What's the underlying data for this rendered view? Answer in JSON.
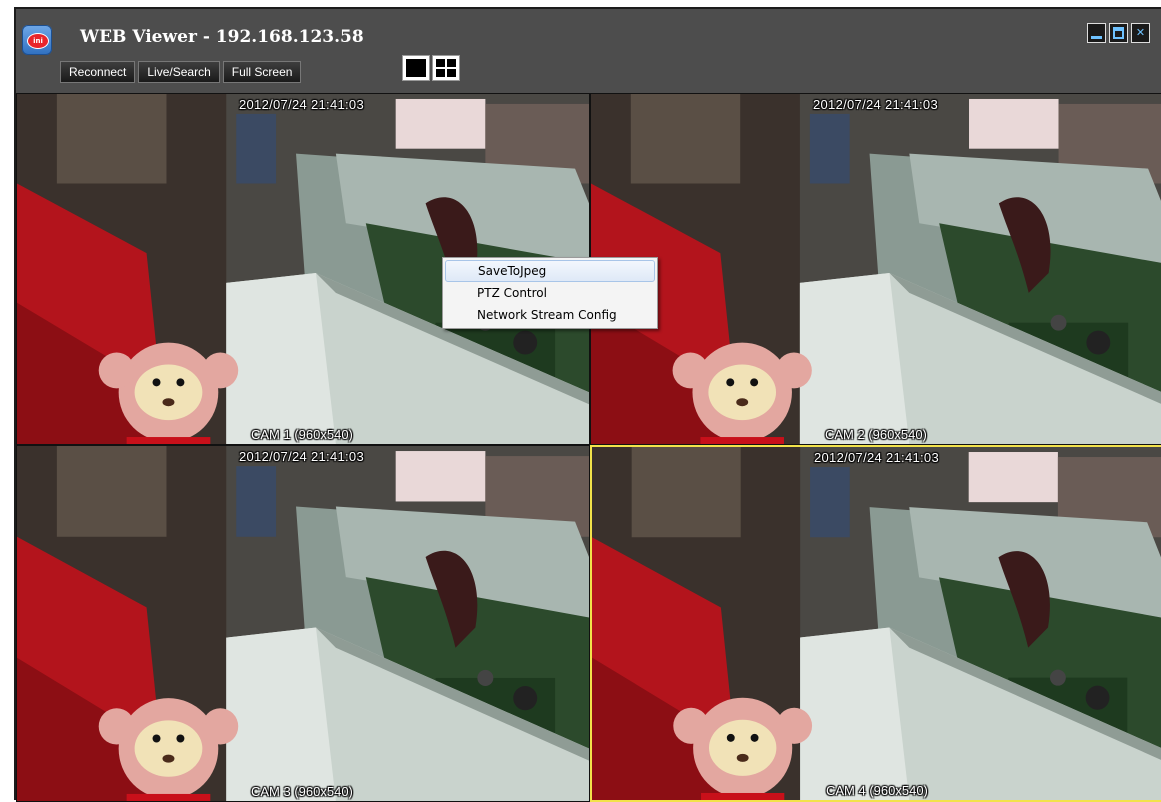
{
  "window": {
    "title": "WEB Viewer - 192.168.123.58",
    "logo_icon": "app-logo-icon",
    "logo_text": "ini"
  },
  "toolbar": {
    "reconnect_label": "Reconnect",
    "live_search_label": "Live/Search",
    "fullscreen_label": "Full Screen"
  },
  "layout_buttons": [
    "single-view-icon",
    "quad-view-icon"
  ],
  "window_controls": [
    "minimize-icon",
    "maximize-icon",
    "close-icon"
  ],
  "cameras": [
    {
      "timestamp": "2012/07/24  21:41:03",
      "label": "CAM 1 (960x540)",
      "selected": false
    },
    {
      "timestamp": "2012/07/24  21:41:03",
      "label": "CAM 2 (960x540)",
      "selected": false
    },
    {
      "timestamp": "2012/07/24  21:41:03",
      "label": "CAM 3 (960x540)",
      "selected": false
    },
    {
      "timestamp": "2012/07/24  21:41:03",
      "label": "CAM 4 (960x540)",
      "selected": true
    }
  ],
  "context_menu": {
    "items": [
      "SaveToJpeg",
      "PTZ Control",
      "Network Stream Config"
    ],
    "hovered_index": 0
  },
  "colors": {
    "selected_border": "#f2e24a",
    "icon_accent": "#6ec2ff"
  }
}
